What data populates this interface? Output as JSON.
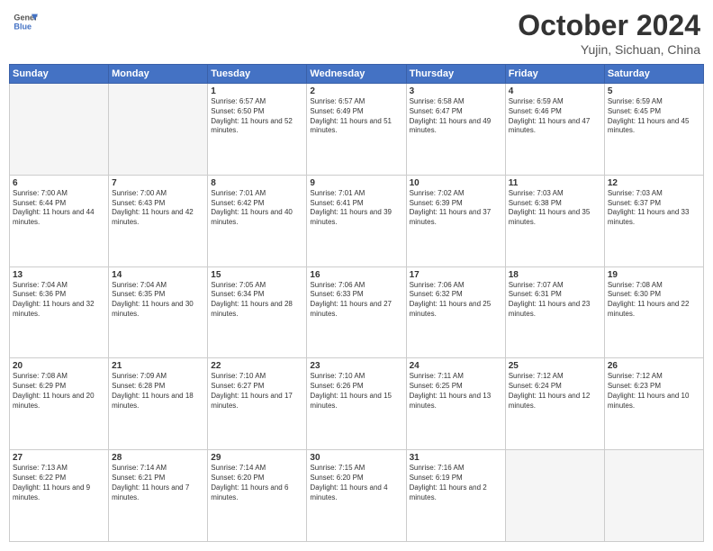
{
  "header": {
    "logo_line1": "General",
    "logo_line2": "Blue",
    "title": "October 2024",
    "subtitle": "Yujin, Sichuan, China"
  },
  "weekdays": [
    "Sunday",
    "Monday",
    "Tuesday",
    "Wednesday",
    "Thursday",
    "Friday",
    "Saturday"
  ],
  "weeks": [
    [
      {
        "day": "",
        "info": ""
      },
      {
        "day": "",
        "info": ""
      },
      {
        "day": "1",
        "info": "Sunrise: 6:57 AM\nSunset: 6:50 PM\nDaylight: 11 hours and 52 minutes."
      },
      {
        "day": "2",
        "info": "Sunrise: 6:57 AM\nSunset: 6:49 PM\nDaylight: 11 hours and 51 minutes."
      },
      {
        "day": "3",
        "info": "Sunrise: 6:58 AM\nSunset: 6:47 PM\nDaylight: 11 hours and 49 minutes."
      },
      {
        "day": "4",
        "info": "Sunrise: 6:59 AM\nSunset: 6:46 PM\nDaylight: 11 hours and 47 minutes."
      },
      {
        "day": "5",
        "info": "Sunrise: 6:59 AM\nSunset: 6:45 PM\nDaylight: 11 hours and 45 minutes."
      }
    ],
    [
      {
        "day": "6",
        "info": "Sunrise: 7:00 AM\nSunset: 6:44 PM\nDaylight: 11 hours and 44 minutes."
      },
      {
        "day": "7",
        "info": "Sunrise: 7:00 AM\nSunset: 6:43 PM\nDaylight: 11 hours and 42 minutes."
      },
      {
        "day": "8",
        "info": "Sunrise: 7:01 AM\nSunset: 6:42 PM\nDaylight: 11 hours and 40 minutes."
      },
      {
        "day": "9",
        "info": "Sunrise: 7:01 AM\nSunset: 6:41 PM\nDaylight: 11 hours and 39 minutes."
      },
      {
        "day": "10",
        "info": "Sunrise: 7:02 AM\nSunset: 6:39 PM\nDaylight: 11 hours and 37 minutes."
      },
      {
        "day": "11",
        "info": "Sunrise: 7:03 AM\nSunset: 6:38 PM\nDaylight: 11 hours and 35 minutes."
      },
      {
        "day": "12",
        "info": "Sunrise: 7:03 AM\nSunset: 6:37 PM\nDaylight: 11 hours and 33 minutes."
      }
    ],
    [
      {
        "day": "13",
        "info": "Sunrise: 7:04 AM\nSunset: 6:36 PM\nDaylight: 11 hours and 32 minutes."
      },
      {
        "day": "14",
        "info": "Sunrise: 7:04 AM\nSunset: 6:35 PM\nDaylight: 11 hours and 30 minutes."
      },
      {
        "day": "15",
        "info": "Sunrise: 7:05 AM\nSunset: 6:34 PM\nDaylight: 11 hours and 28 minutes."
      },
      {
        "day": "16",
        "info": "Sunrise: 7:06 AM\nSunset: 6:33 PM\nDaylight: 11 hours and 27 minutes."
      },
      {
        "day": "17",
        "info": "Sunrise: 7:06 AM\nSunset: 6:32 PM\nDaylight: 11 hours and 25 minutes."
      },
      {
        "day": "18",
        "info": "Sunrise: 7:07 AM\nSunset: 6:31 PM\nDaylight: 11 hours and 23 minutes."
      },
      {
        "day": "19",
        "info": "Sunrise: 7:08 AM\nSunset: 6:30 PM\nDaylight: 11 hours and 22 minutes."
      }
    ],
    [
      {
        "day": "20",
        "info": "Sunrise: 7:08 AM\nSunset: 6:29 PM\nDaylight: 11 hours and 20 minutes."
      },
      {
        "day": "21",
        "info": "Sunrise: 7:09 AM\nSunset: 6:28 PM\nDaylight: 11 hours and 18 minutes."
      },
      {
        "day": "22",
        "info": "Sunrise: 7:10 AM\nSunset: 6:27 PM\nDaylight: 11 hours and 17 minutes."
      },
      {
        "day": "23",
        "info": "Sunrise: 7:10 AM\nSunset: 6:26 PM\nDaylight: 11 hours and 15 minutes."
      },
      {
        "day": "24",
        "info": "Sunrise: 7:11 AM\nSunset: 6:25 PM\nDaylight: 11 hours and 13 minutes."
      },
      {
        "day": "25",
        "info": "Sunrise: 7:12 AM\nSunset: 6:24 PM\nDaylight: 11 hours and 12 minutes."
      },
      {
        "day": "26",
        "info": "Sunrise: 7:12 AM\nSunset: 6:23 PM\nDaylight: 11 hours and 10 minutes."
      }
    ],
    [
      {
        "day": "27",
        "info": "Sunrise: 7:13 AM\nSunset: 6:22 PM\nDaylight: 11 hours and 9 minutes."
      },
      {
        "day": "28",
        "info": "Sunrise: 7:14 AM\nSunset: 6:21 PM\nDaylight: 11 hours and 7 minutes."
      },
      {
        "day": "29",
        "info": "Sunrise: 7:14 AM\nSunset: 6:20 PM\nDaylight: 11 hours and 6 minutes."
      },
      {
        "day": "30",
        "info": "Sunrise: 7:15 AM\nSunset: 6:20 PM\nDaylight: 11 hours and 4 minutes."
      },
      {
        "day": "31",
        "info": "Sunrise: 7:16 AM\nSunset: 6:19 PM\nDaylight: 11 hours and 2 minutes."
      },
      {
        "day": "",
        "info": ""
      },
      {
        "day": "",
        "info": ""
      }
    ]
  ]
}
